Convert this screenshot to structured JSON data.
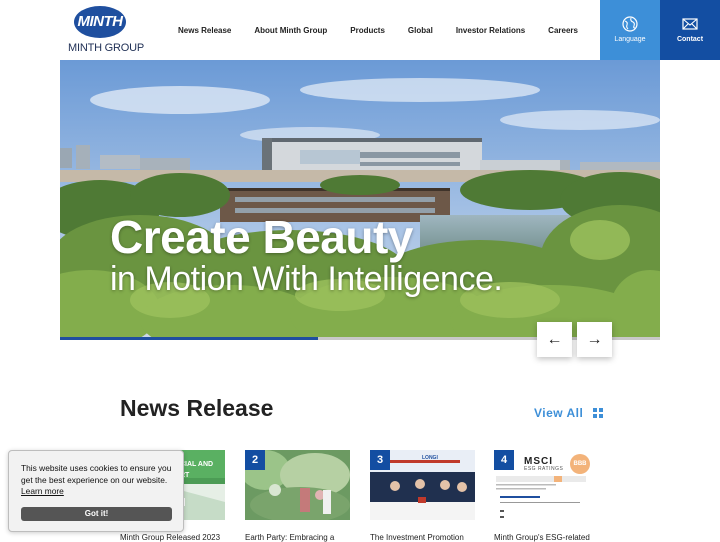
{
  "brand": {
    "logo_mark": "MINTH",
    "logo_word": "MINTH GROUP",
    "primary_color": "#134ea2",
    "accent_color": "#3d8fd8"
  },
  "nav": {
    "items": [
      {
        "label": "News Release"
      },
      {
        "label": "About Minth Group"
      },
      {
        "label": "Products"
      },
      {
        "label": "Global"
      },
      {
        "label": "Investor Relations"
      },
      {
        "label": "Careers"
      }
    ],
    "language_label": "Language",
    "language_icon": "globe-icon",
    "contact_label": "Contact",
    "contact_icon": "mail-icon"
  },
  "hero": {
    "title": "Create Beauty",
    "subtitle": "in Motion With Intelligence.",
    "progress": 0.43,
    "prev_label": "←",
    "next_label": "→"
  },
  "news": {
    "heading": "News Release",
    "view_all_label": "View All",
    "view_all_icon": "grid-icon",
    "cards": [
      {
        "number": "",
        "title": "Minth Group Released 2023",
        "image_text": "CIAL AND\nRT"
      },
      {
        "number": "2",
        "title": "Earth Party: Embracing a"
      },
      {
        "number": "3",
        "title": "The Investment Promotion",
        "image_text": "LONGI"
      },
      {
        "number": "4",
        "title": "Minth Group's ESG-related",
        "image_text": "MSCI",
        "image_subtext": "ESG RATINGS",
        "rating_badge": "BBB"
      }
    ]
  },
  "cookie": {
    "message": "This website uses cookies to ensure you get the best experience on our website.",
    "link_label": "Learn more",
    "button_label": "Got it!"
  }
}
